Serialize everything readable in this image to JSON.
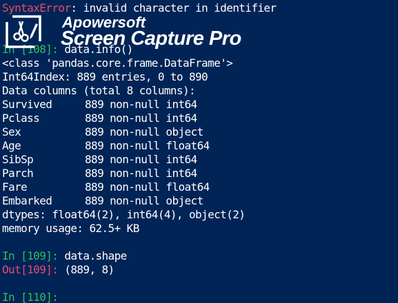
{
  "console": {
    "error_line": {
      "label": "SyntaxError",
      "message": ": invalid character in identifier"
    },
    "in_108": {
      "prompt": "In [108]:",
      "code": " data.info()"
    },
    "info_output": {
      "class_line": "<class 'pandas.core.frame.DataFrame'>",
      "index_line": "Int64Index: 889 entries, 0 to 890",
      "columns_header": "Data columns (total 8 columns):",
      "columns": [
        {
          "name": "Survived",
          "info": "889 non-null int64"
        },
        {
          "name": "Pclass",
          "info": "889 non-null int64"
        },
        {
          "name": "Sex",
          "info": "889 non-null object"
        },
        {
          "name": "Age",
          "info": "889 non-null float64"
        },
        {
          "name": "SibSp",
          "info": "889 non-null int64"
        },
        {
          "name": "Parch",
          "info": "889 non-null int64"
        },
        {
          "name": "Fare",
          "info": "889 non-null float64"
        },
        {
          "name": "Embarked",
          "info": "889 non-null object"
        }
      ],
      "dtypes_line": "dtypes: float64(2), int64(4), object(2)",
      "memory_line": "memory usage: 62.5+ KB"
    },
    "in_109": {
      "prompt": "In [109]:",
      "code": " data.shape"
    },
    "out_109": {
      "prompt": "Out[109]:",
      "value": " (889, 8)"
    },
    "in_110": {
      "prompt": "In [110]:",
      "code": ""
    }
  },
  "watermark": {
    "brand": "Apowersoft",
    "product": "Screen Capture Pro",
    "logo_icon": "scissors-pen-icon"
  },
  "colors": {
    "background": "#012456",
    "text": "#ffffff",
    "prompt_in": "#2fbf5b",
    "prompt_out": "#e64b6e",
    "error": "#e64b6e"
  }
}
